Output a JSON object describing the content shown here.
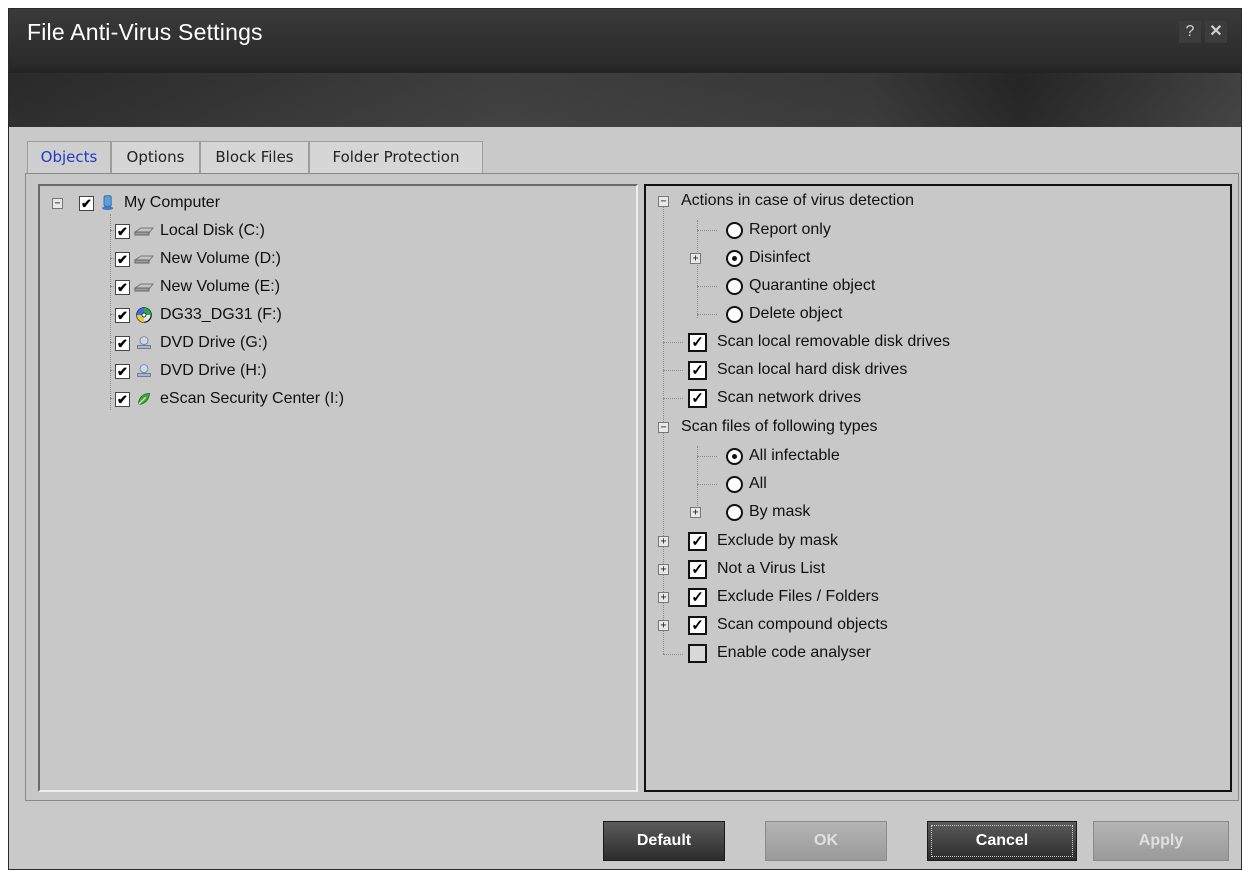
{
  "window": {
    "title": "File Anti-Virus Settings",
    "help_label": "?",
    "close_label": "✕"
  },
  "tabs": [
    {
      "label": "Objects",
      "active": true
    },
    {
      "label": "Options",
      "active": false
    },
    {
      "label": "Block Files",
      "active": false
    },
    {
      "label": "Folder Protection",
      "active": false
    }
  ],
  "objects_tree": {
    "root": {
      "label": "My Computer",
      "checked": true,
      "icon": "computer-icon"
    },
    "items": [
      {
        "label": "Local Disk (C:)",
        "checked": true,
        "icon": "hard-disk-icon"
      },
      {
        "label": "New Volume (D:)",
        "checked": true,
        "icon": "hard-disk-icon"
      },
      {
        "label": "New Volume (E:)",
        "checked": true,
        "icon": "hard-disk-icon"
      },
      {
        "label": "DG33_DG31 (F:)",
        "checked": true,
        "icon": "cd-disc-icon"
      },
      {
        "label": "DVD Drive (G:)",
        "checked": true,
        "icon": "dvd-drive-icon"
      },
      {
        "label": "DVD Drive (H:)",
        "checked": true,
        "icon": "dvd-drive-icon"
      },
      {
        "label": "eScan Security Center (I:)",
        "checked": true,
        "icon": "escan-icon"
      }
    ]
  },
  "options_tree": {
    "actions_group": "Actions in case of virus detection",
    "actions": [
      {
        "label": "Report only",
        "selected": false
      },
      {
        "label": "Disinfect",
        "selected": true
      },
      {
        "label": "Quarantine object",
        "selected": false
      },
      {
        "label": "Delete object",
        "selected": false
      }
    ],
    "scan_drives": [
      {
        "label": "Scan local removable disk drives",
        "checked": true
      },
      {
        "label": "Scan local hard disk drives",
        "checked": true
      },
      {
        "label": "Scan network drives",
        "checked": true
      }
    ],
    "file_types_group": "Scan files of following types",
    "file_types": [
      {
        "label": "All infectable",
        "selected": true
      },
      {
        "label": "All",
        "selected": false
      },
      {
        "label": "By mask",
        "selected": false
      }
    ],
    "extras": [
      {
        "label": "Exclude by mask",
        "checked": true
      },
      {
        "label": "Not a Virus List",
        "checked": true
      },
      {
        "label": "Exclude Files / Folders",
        "checked": true
      },
      {
        "label": "Scan compound objects",
        "checked": true
      },
      {
        "label": "Enable code analyser",
        "checked": false
      }
    ]
  },
  "buttons": {
    "default": "Default",
    "ok": "OK",
    "cancel": "Cancel",
    "apply": "Apply"
  },
  "glyphs": {
    "check": "✔",
    "tick": "✓",
    "minus": "−",
    "plus": "+"
  }
}
